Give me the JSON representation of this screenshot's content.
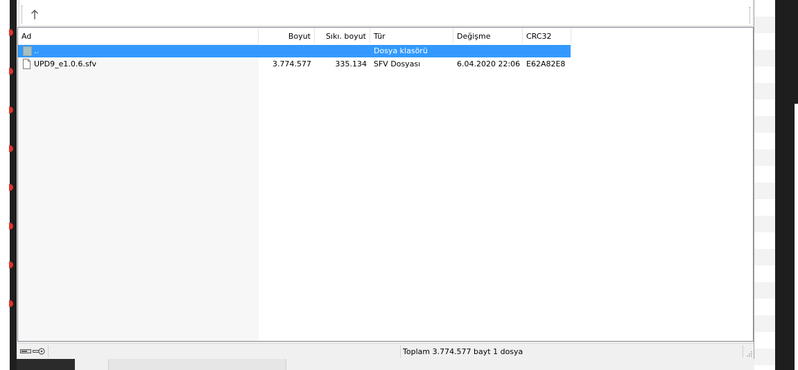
{
  "columns": {
    "name": "Ad",
    "size": "Boyut",
    "packed_size": "Sıkı. boyut",
    "type": "Tür",
    "modified": "Değişme",
    "crc": "CRC32"
  },
  "rows": [
    {
      "name": "..",
      "size": "",
      "packed_size": "",
      "type": "Dosya klasörü",
      "modified": "",
      "crc": "",
      "icon": "folder-up-icon",
      "selected": true
    },
    {
      "name": "UPD9_e1.0.6.sfv",
      "size": "3.774.577",
      "packed_size": "335.134",
      "type": "SFV Dosyası",
      "modified": "6.04.2020 22:06",
      "crc": "E62A82E8",
      "icon": "file-icon",
      "selected": false
    }
  ],
  "statusbar": {
    "summary": "Toplam 3.774.577 bayt 1 dosya",
    "icons": [
      "drive-icon",
      "key-icon"
    ]
  },
  "colors": {
    "selection": "#3399ff",
    "selection_text": "#ffffff",
    "name_column_shade": "#f7f7f7",
    "folder_icon": "#a7bfc1"
  }
}
